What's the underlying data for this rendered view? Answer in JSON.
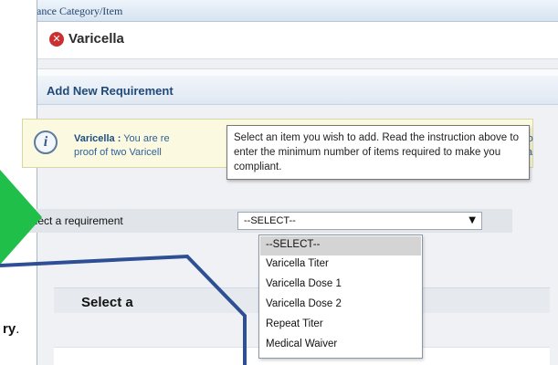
{
  "window": {
    "title": "Compliance Category/Item"
  },
  "item": {
    "title": "Varicella",
    "status_icon": "x-circle-icon"
  },
  "section": {
    "title": "Add New Requirement"
  },
  "info": {
    "lead": "Varicella :",
    "line1": "You are re",
    "line2": "proof of two Varicell",
    "right1": "If yo",
    "right2": "cina"
  },
  "tooltip": {
    "text": "Select an item you wish to add. Read the instruction above to enter the minimum number of items required to make you compliant."
  },
  "requirement": {
    "label": "Select a requirement",
    "selected": "--SELECT--"
  },
  "dropdown": {
    "options": [
      "--SELECT--",
      "Varicella Titer",
      "Varicella Dose 1",
      "Varicella Dose 2",
      "Repeat Titer",
      "Medical Waiver"
    ]
  },
  "callout": {
    "line1": "Select a",
    "line2": "ry",
    "line2_suffix": "."
  },
  "colors": {
    "arrow": "#1fbf4a",
    "callout_border": "#2e4f93",
    "error": "#cc2f2f"
  }
}
